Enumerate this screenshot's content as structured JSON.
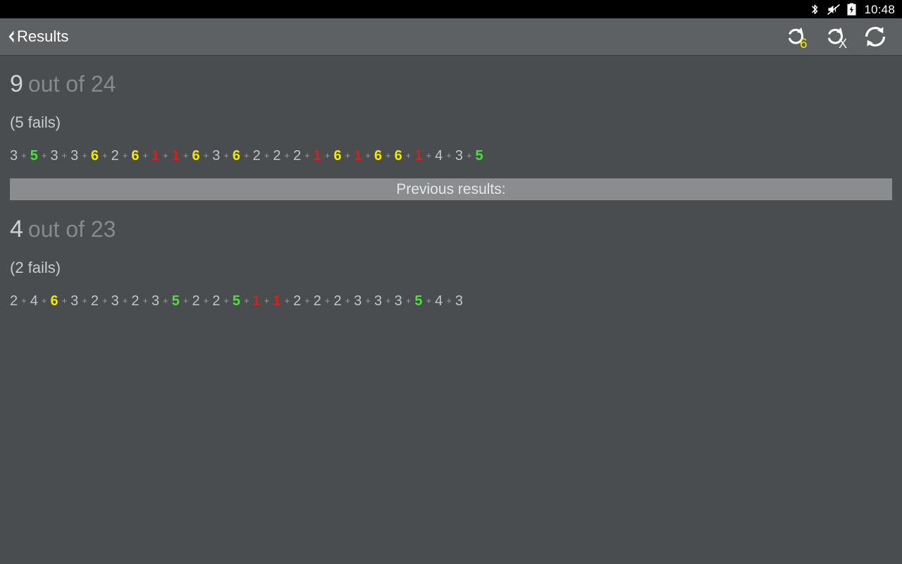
{
  "status_bar": {
    "icons": [
      "bluetooth-icon",
      "volume-muted-icon",
      "battery-charging-icon"
    ],
    "clock": "10:48"
  },
  "action_bar": {
    "back_label": "Results",
    "back_icon": "chevron-left-icon",
    "actions": [
      {
        "name": "repeat-count-button",
        "icon": "reload-icon",
        "badge": "6",
        "badge_color": "#f2e800"
      },
      {
        "name": "repeat-clear-button",
        "icon": "reload-icon",
        "badge": "X",
        "badge_color": "#ffffff"
      },
      {
        "name": "refresh-button",
        "icon": "sync-icon",
        "badge": "",
        "badge_color": "#ffffff"
      }
    ]
  },
  "divider": {
    "label": "Previous results:"
  },
  "colors": {
    "background": "#4a4d4f",
    "action_bar": "#5e6163",
    "divider": "#8a8c8e",
    "normal": "#c2c4c5",
    "green": "#4ee039",
    "yellow": "#f2e800",
    "red": "#e01b1b"
  },
  "current_result": {
    "score": "9",
    "score_rest": "out of 24",
    "score_value": 9,
    "total": 24,
    "fails": "(5 fails)",
    "fails_count": 5,
    "separator": "+",
    "values": [
      {
        "value": "3",
        "color": "normal"
      },
      {
        "value": "5",
        "color": "green"
      },
      {
        "value": "3",
        "color": "normal"
      },
      {
        "value": "3",
        "color": "normal"
      },
      {
        "value": "6",
        "color": "yellow"
      },
      {
        "value": "2",
        "color": "normal"
      },
      {
        "value": "6",
        "color": "yellow"
      },
      {
        "value": "1",
        "color": "red"
      },
      {
        "value": "1",
        "color": "red"
      },
      {
        "value": "6",
        "color": "yellow"
      },
      {
        "value": "3",
        "color": "normal"
      },
      {
        "value": "6",
        "color": "yellow"
      },
      {
        "value": "2",
        "color": "normal"
      },
      {
        "value": "2",
        "color": "normal"
      },
      {
        "value": "2",
        "color": "normal"
      },
      {
        "value": "1",
        "color": "red"
      },
      {
        "value": "6",
        "color": "yellow"
      },
      {
        "value": "1",
        "color": "red"
      },
      {
        "value": "6",
        "color": "yellow"
      },
      {
        "value": "6",
        "color": "yellow"
      },
      {
        "value": "1",
        "color": "red"
      },
      {
        "value": "4",
        "color": "normal"
      },
      {
        "value": "3",
        "color": "normal"
      },
      {
        "value": "5",
        "color": "green"
      }
    ]
  },
  "previous_result": {
    "score": "4",
    "score_rest": "out of 23",
    "score_value": 4,
    "total": 23,
    "fails": "(2 fails)",
    "fails_count": 2,
    "separator": "+",
    "values": [
      {
        "value": "2",
        "color": "normal"
      },
      {
        "value": "4",
        "color": "normal"
      },
      {
        "value": "6",
        "color": "yellow"
      },
      {
        "value": "3",
        "color": "normal"
      },
      {
        "value": "2",
        "color": "normal"
      },
      {
        "value": "3",
        "color": "normal"
      },
      {
        "value": "2",
        "color": "normal"
      },
      {
        "value": "3",
        "color": "normal"
      },
      {
        "value": "5",
        "color": "green"
      },
      {
        "value": "2",
        "color": "normal"
      },
      {
        "value": "2",
        "color": "normal"
      },
      {
        "value": "5",
        "color": "green"
      },
      {
        "value": "1",
        "color": "red"
      },
      {
        "value": "1",
        "color": "red"
      },
      {
        "value": "2",
        "color": "normal"
      },
      {
        "value": "2",
        "color": "normal"
      },
      {
        "value": "2",
        "color": "normal"
      },
      {
        "value": "3",
        "color": "normal"
      },
      {
        "value": "3",
        "color": "normal"
      },
      {
        "value": "3",
        "color": "normal"
      },
      {
        "value": "5",
        "color": "green"
      },
      {
        "value": "4",
        "color": "normal"
      },
      {
        "value": "3",
        "color": "normal"
      }
    ]
  }
}
